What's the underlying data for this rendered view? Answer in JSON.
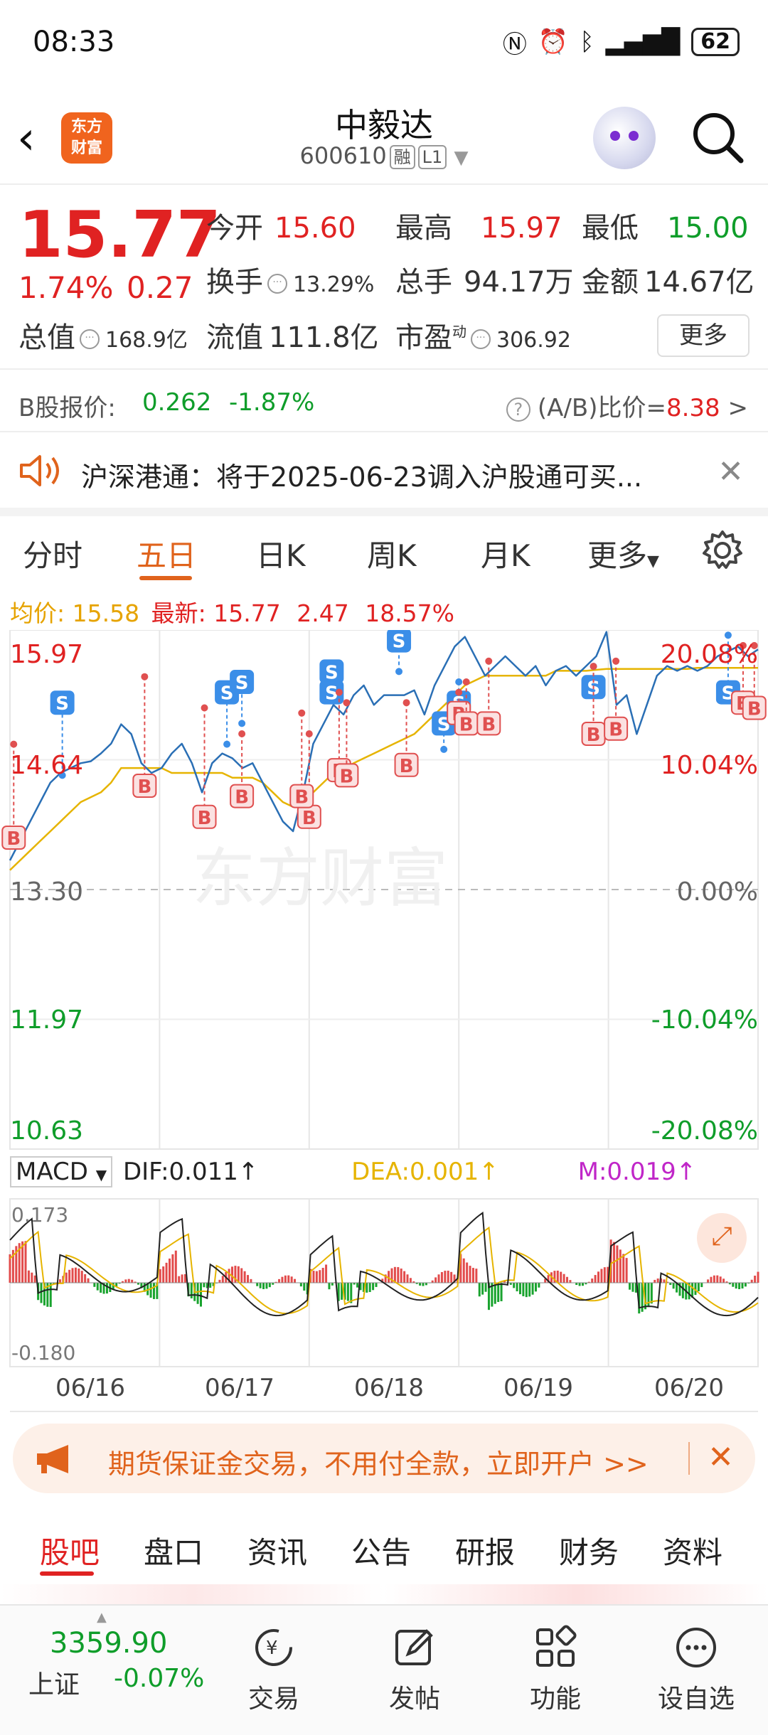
{
  "status_bar": {
    "time": "08:33",
    "battery": "62"
  },
  "header": {
    "stock_name": "中毅达",
    "stock_code": "600610",
    "tag_margin": "融",
    "tag_level": "L1",
    "logo_line1": "东方",
    "logo_line2": "财富"
  },
  "quote": {
    "price": "15.77",
    "change_pct": "1.74%",
    "change_abs": "0.27",
    "open_label": "今开",
    "open": "15.60",
    "high_label": "最高",
    "high": "15.97",
    "low_label": "最低",
    "low": "15.00",
    "turnover_label": "换手",
    "turnover": "13.29%",
    "volume_label": "总手",
    "volume": "94.17万",
    "amount_label": "金额",
    "amount": "14.67亿",
    "mktcap_label": "总值",
    "mktcap": "168.9亿",
    "float_label": "流值",
    "float": "111.8亿",
    "pe_label": "市盈",
    "pe_sup": "动",
    "pe": "306.92",
    "more_label": "更多"
  },
  "bshare": {
    "label": "B股报价:",
    "price": "0.262",
    "change": "-1.87%",
    "ratio_label": "(A/B)比价=",
    "ratio": "8.38",
    "arrow": ">"
  },
  "notice": {
    "text": "沪深港通：将于2025-06-23调入沪股通可买..."
  },
  "chart_tabs": [
    "分时",
    "五日",
    "日K",
    "周K",
    "月K",
    "更多"
  ],
  "active_tab": "五日",
  "legend": {
    "avg_label": "均价:",
    "avg": "15.58",
    "latest_label": "最新:",
    "latest": "15.77",
    "chg": "2.47",
    "chg_pct": "18.57%"
  },
  "chart_data": {
    "type": "line",
    "title": "",
    "dates": [
      "06/16",
      "06/17",
      "06/18",
      "06/19",
      "06/20"
    ],
    "y_left_ticks": [
      "15.97",
      "14.64",
      "13.30",
      "11.97",
      "10.63"
    ],
    "y_right_ticks": [
      "20.08%",
      "10.04%",
      "0.00%",
      "-10.04%",
      "-20.08%"
    ],
    "ylim": [
      10.63,
      15.97
    ],
    "prev_close": 13.3,
    "series": [
      {
        "name": "",
        "values": [
          13.6,
          13.8,
          14.0,
          14.2,
          14.4,
          14.5,
          14.55,
          14.6,
          14.62,
          14.7,
          14.8,
          15.0,
          14.9,
          14.6,
          14.5,
          14.55,
          14.7,
          14.8,
          14.6,
          14.3,
          14.6,
          14.7,
          14.65,
          14.55,
          14.6,
          14.4,
          14.2,
          14.0,
          13.9,
          14.3,
          14.8,
          15.0,
          15.2,
          15.1,
          15.3,
          15.4,
          15.2,
          15.3,
          15.3,
          15.3,
          15.35,
          15.1,
          15.4,
          15.6,
          15.8,
          15.9,
          15.7,
          15.5,
          15.6,
          15.7,
          15.6,
          15.5,
          15.6,
          15.4,
          15.55,
          15.6,
          15.5,
          15.6,
          15.7,
          15.95,
          15.2,
          15.3,
          14.9,
          15.2,
          15.5,
          15.6,
          15.55,
          15.6,
          15.55,
          15.6,
          15.7,
          15.75,
          15.8,
          15.7,
          15.77
        ]
      },
      {
        "name": "",
        "values": [
          13.5,
          13.6,
          13.7,
          13.8,
          13.9,
          14.0,
          14.1,
          14.2,
          14.25,
          14.3,
          14.4,
          14.55,
          14.55,
          14.55,
          14.55,
          14.55,
          14.5,
          14.5,
          14.5,
          14.5,
          14.5,
          14.5,
          14.45,
          14.45,
          14.45,
          14.4,
          14.3,
          14.2,
          14.15,
          14.2,
          14.3,
          14.4,
          14.5,
          14.55,
          14.6,
          14.65,
          14.7,
          14.75,
          14.8,
          14.85,
          14.9,
          15.0,
          15.1,
          15.2,
          15.3,
          15.4,
          15.45,
          15.5,
          15.5,
          15.5,
          15.5,
          15.5,
          15.5,
          15.5,
          15.55,
          15.55,
          15.55,
          15.55,
          15.56,
          15.57,
          15.57,
          15.57,
          15.57,
          15.57,
          15.57,
          15.57,
          15.57,
          15.57,
          15.58,
          15.58,
          15.58,
          15.58,
          15.58,
          15.58,
          15.58
        ]
      }
    ],
    "markers_note": "B/S trade markers",
    "macd": {
      "selector": "MACD",
      "dif": "DIF:0.011",
      "dea": "DEA:0.001",
      "m": "M:0.019",
      "y_top": "0.173",
      "y_bottom": "-0.180"
    }
  },
  "banner": {
    "text": "期货保证金交易，不用付全款，立即开户 >>"
  },
  "section_tabs": [
    "股吧",
    "盘口",
    "资讯",
    "公告",
    "研报",
    "财务",
    "资料"
  ],
  "bottom_nav": {
    "index_value": "3359.90",
    "index_name": "上证",
    "index_change": "-0.07%",
    "items": [
      "交易",
      "发帖",
      "功能",
      "设自选"
    ]
  },
  "colors": {
    "up": "#e02222",
    "down": "#0f9d2a",
    "accent": "#e0631c",
    "avg_line": "#e6b400",
    "price_line": "#2a6fb5"
  }
}
